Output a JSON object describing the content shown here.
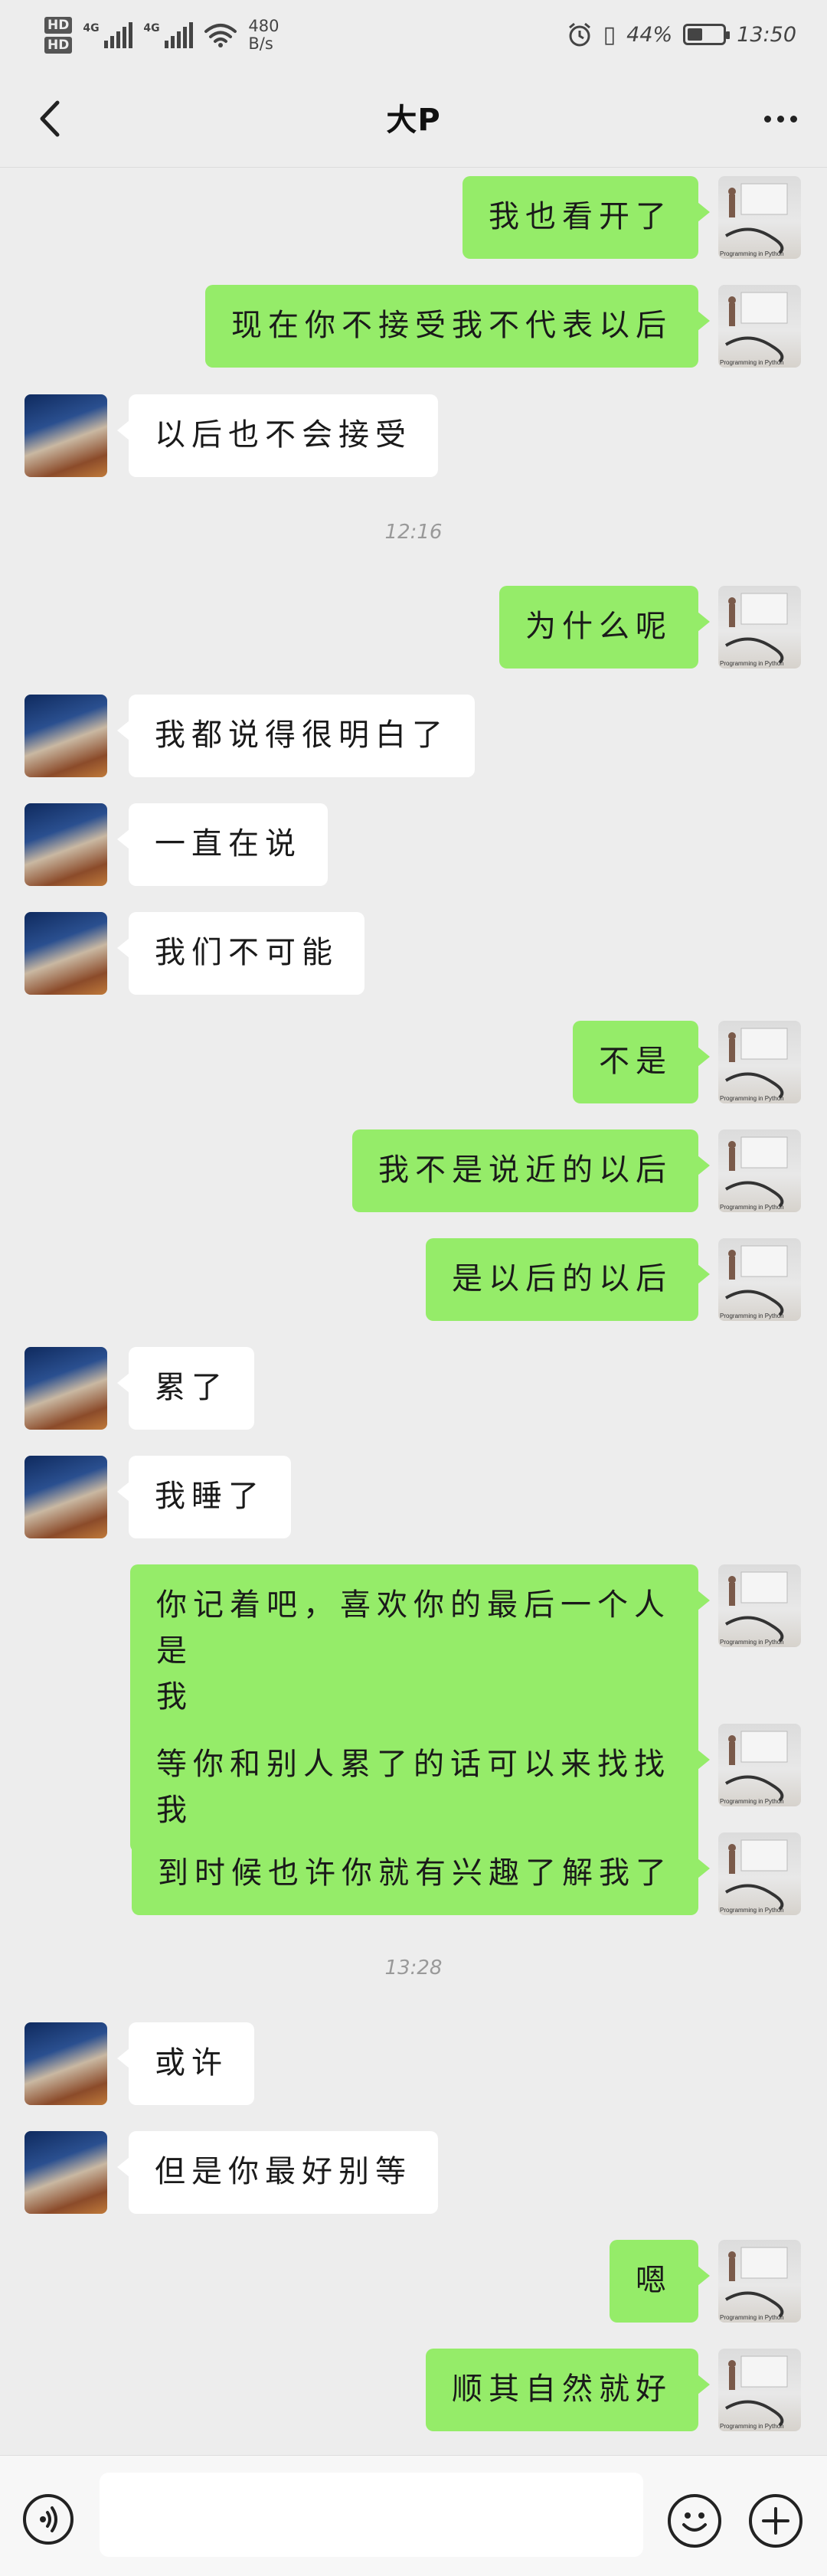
{
  "status_bar": {
    "hd1": "HD",
    "hd2": "HD",
    "net1": "4G",
    "net2": "4G",
    "speed_value": "480",
    "speed_unit": "B/s",
    "battery_text": "44%",
    "battery_level": 0.44,
    "time": "13:50"
  },
  "chat": {
    "title": "大P"
  },
  "messages": [
    {
      "from": "me",
      "text": "我也看开了"
    },
    {
      "from": "me",
      "text": "现在你不接受我不代表以后"
    },
    {
      "from": "them",
      "text": "以后也不会接受"
    },
    {
      "timestamp": "12:16"
    },
    {
      "from": "me",
      "text": "为什么呢"
    },
    {
      "from": "them",
      "text": "我都说得很明白了"
    },
    {
      "from": "them",
      "text": "一直在说"
    },
    {
      "from": "them",
      "text": "我们不可能"
    },
    {
      "from": "me",
      "text": "不是"
    },
    {
      "from": "me",
      "text": "我不是说近的以后"
    },
    {
      "from": "me",
      "text": "是以后的以后"
    },
    {
      "from": "them",
      "text": "累了"
    },
    {
      "from": "them",
      "text": "我睡了"
    },
    {
      "from": "me",
      "text": "你记着吧，喜欢你的最后一个人是\n我"
    },
    {
      "from": "me",
      "text": "等你和别人累了的话可以来找找我"
    },
    {
      "from": "me",
      "text": "到时候也许你就有兴趣了解我了"
    },
    {
      "timestamp": "13:28"
    },
    {
      "from": "them",
      "text": "或许"
    },
    {
      "from": "them",
      "text": "但是你最好别等"
    },
    {
      "from": "me",
      "text": "嗯"
    },
    {
      "from": "me",
      "text": "顺其自然就好"
    }
  ],
  "avatar_caption_me": "Programming in Python",
  "input": {
    "placeholder": "",
    "value": ""
  },
  "icons": {
    "back": "chevron-left-icon",
    "more": "more-dots-icon",
    "voice": "voice-icon",
    "emoji": "emoji-icon",
    "plus": "plus-icon"
  },
  "colors": {
    "background": "#ededed",
    "my_bubble": "#95ec69",
    "their_bubble": "#ffffff"
  }
}
